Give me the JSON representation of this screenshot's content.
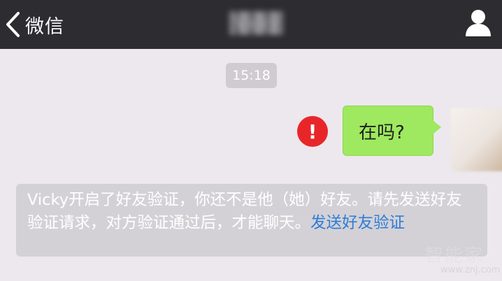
{
  "header": {
    "back_label": "微信",
    "contact_name": "Vicky"
  },
  "chat": {
    "timestamp": "15:18",
    "message": {
      "text": "在吗?",
      "status_icon": "!",
      "status_color": "#e8262a",
      "bubble_color": "#9ee95f"
    },
    "notice": {
      "text": "Vicky开启了好友验证，你还不是他（她）好友。请先发送好友验证请求，对方验证通过后，才能聊天。",
      "link": "发送好友验证",
      "link_color": "#2d7cd8"
    }
  },
  "watermark": {
    "title": "智能家",
    "domain": "www.znj.com"
  },
  "icons": {
    "back": "chevron-left-icon",
    "profile": "person-icon",
    "failed": "exclamation-icon"
  }
}
